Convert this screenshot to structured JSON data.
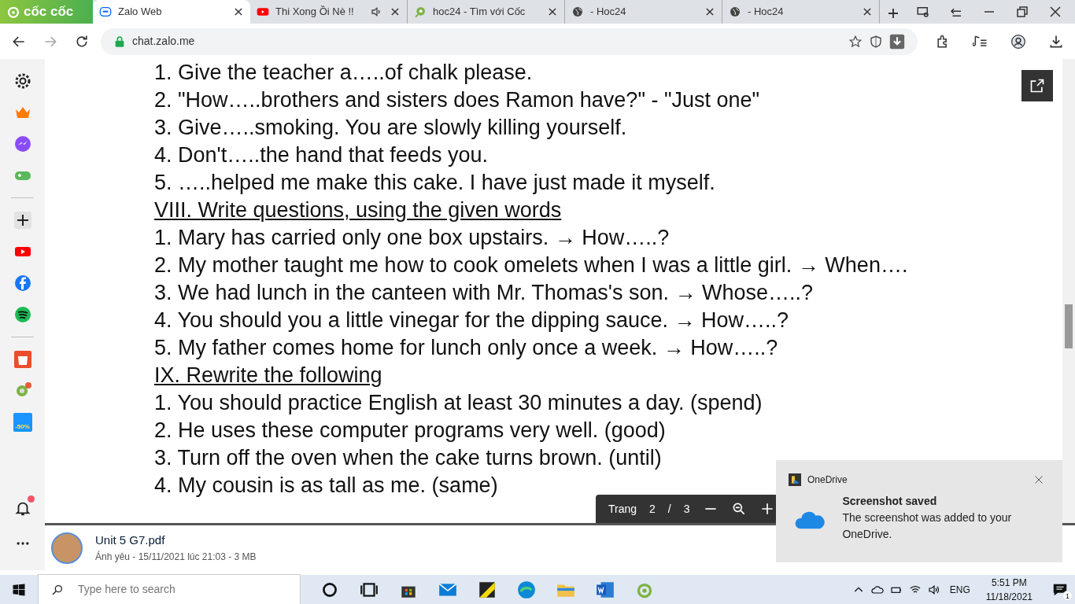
{
  "browser": {
    "brand": "cốc cốc",
    "tabs": [
      {
        "title": "Zalo Web",
        "selected": true,
        "kind": "zalo",
        "audio": false
      },
      {
        "title": "Thi Xong Ồi Nè !!",
        "selected": false,
        "kind": "youtube",
        "audio": true
      },
      {
        "title": "hoc24 - Tìm với Cốc",
        "selected": false,
        "kind": "hoc24",
        "audio": false
      },
      {
        "title": "- Hoc24",
        "selected": false,
        "kind": "globe",
        "audio": false
      },
      {
        "title": "- Hoc24",
        "selected": false,
        "kind": "globe",
        "audio": false
      }
    ],
    "url": "chat.zalo.me"
  },
  "sidebar": {
    "promo_label": "-50%",
    "bell_unread": true
  },
  "document": {
    "lines": [
      {
        "kind": "item",
        "text": "1. Give the teacher a…..of chalk please."
      },
      {
        "kind": "item",
        "text": "2. \"How…..brothers and sisters does Ramon have?\" - \"Just one\""
      },
      {
        "kind": "item",
        "text": "3. Give…..smoking. You are slowly killing yourself."
      },
      {
        "kind": "item",
        "text": "4. Don't…..the hand that feeds you."
      },
      {
        "kind": "item",
        "text": "5. …..helped me make this cake. I have just made it myself."
      },
      {
        "kind": "heading",
        "text": "VIII. Write questions, using the given words"
      },
      {
        "kind": "item",
        "text": "1. Mary has carried only one box upstairs. → How…..?"
      },
      {
        "kind": "item",
        "text": "2. My mother taught me how to cook omelets when I was a little girl. → When…."
      },
      {
        "kind": "item",
        "text": "3. We had lunch in the canteen with Mr. Thomas's son. → Whose…..?"
      },
      {
        "kind": "item",
        "text": "4. You should you a little vinegar for the dipping sauce. → How…..?"
      },
      {
        "kind": "item",
        "text": "5. My father comes home for lunch only once a week. → How…..?"
      },
      {
        "kind": "heading",
        "text": "IX. Rewrite the following"
      },
      {
        "kind": "item",
        "text": "1. You should practice English at least 30 minutes a day. (spend)"
      },
      {
        "kind": "item",
        "text": "2. He uses these computer programs very well. (good)"
      },
      {
        "kind": "item",
        "text": "3. Turn off the oven when the cake turns brown. (until)"
      },
      {
        "kind": "item",
        "text": "4. My cousin is as tall as me. (same)"
      }
    ],
    "page_control": {
      "label": "Trang",
      "current": "2",
      "separator": "/",
      "total": "3"
    }
  },
  "file": {
    "name": "Unit 5 G7.pdf",
    "meta": "Ánh yêu - 15/11/2021 lúc 21:03 - 3 MB"
  },
  "notification": {
    "app": "OneDrive",
    "title": "Screenshot saved",
    "body": "The screenshot was added to your OneDrive."
  },
  "taskbar": {
    "search_placeholder": "Type here to search",
    "language": "ENG",
    "time": "5:51 PM",
    "date": "11/18/2021",
    "notification_count": "1"
  }
}
